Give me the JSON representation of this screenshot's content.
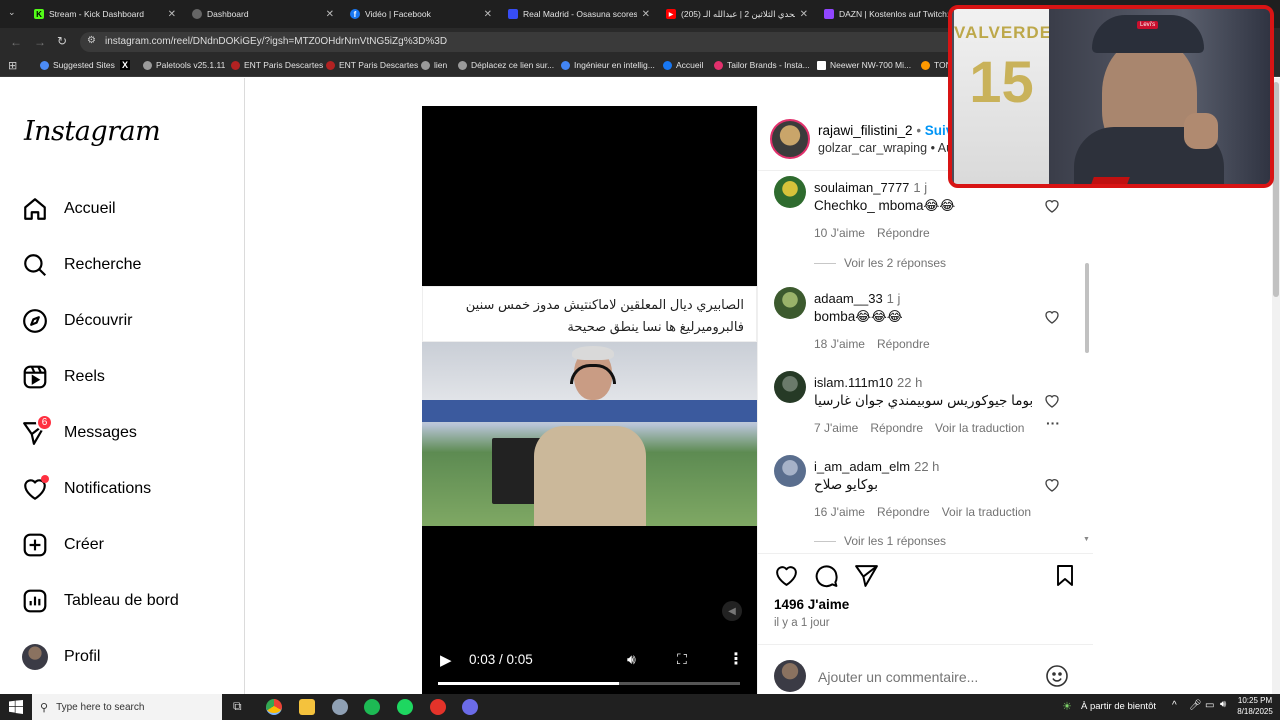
{
  "browser": {
    "tabs": [
      {
        "title": "Stream - Kick Dashboard",
        "icon": "kick-icon",
        "color": "#53fc18",
        "glyph": "K"
      },
      {
        "title": "Dashboard",
        "icon": "globe-icon",
        "color": "#888888",
        "glyph": ""
      },
      {
        "title": "Vidéo | Facebook",
        "icon": "facebook-icon",
        "color": "#1877f2",
        "glyph": "f"
      },
      {
        "title": "Real Madrid - Osasuna scores ...",
        "icon": "sofascore-icon",
        "color": "#374df5",
        "glyph": ""
      },
      {
        "title": "تحدي الثلاثين 2 | عبدالله الـ (205)",
        "icon": "youtube-icon",
        "color": "#ff0000",
        "glyph": "▶"
      },
      {
        "title": "DAZN | Kostenlos auf Twitch: ...",
        "icon": "twitch-icon",
        "color": "#9146ff",
        "glyph": ""
      }
    ],
    "url": "instagram.com/reel/DNdnDOKiGEy/?igsh=MTZ0OHdrNmVtNG5iZg%3D%3D",
    "bookmarks": [
      {
        "label": "Suggested Sites",
        "color": "#4c8bf5"
      },
      {
        "label": "",
        "color": "#000000",
        "glyph": "X"
      },
      {
        "label": "Paletools v25.1.11",
        "color": "#9a9a9a"
      },
      {
        "label": "ENT Paris Descartes",
        "color": "#b22222"
      },
      {
        "label": "ENT Paris Descartes",
        "color": "#b22222"
      },
      {
        "label": "lien",
        "color": "#9a9a9a"
      },
      {
        "label": "Déplacez ce lien sur...",
        "color": "#9a9a9a"
      },
      {
        "label": "Ingénieur en intellig...",
        "color": "#4285f4"
      },
      {
        "label": "Accueil",
        "color": "#1877f2"
      },
      {
        "label": "Tailor Brands - Insta...",
        "color": "#e1306c"
      },
      {
        "label": "Neewer NW-700 Mi...",
        "color": "#ffffff"
      },
      {
        "label": "TON",
        "color": "#ff9900"
      }
    ]
  },
  "sidebar": {
    "logo": "Instagram",
    "items": [
      {
        "label": "Accueil",
        "icon": "home-icon"
      },
      {
        "label": "Recherche",
        "icon": "search-icon"
      },
      {
        "label": "Découvrir",
        "icon": "compass-icon"
      },
      {
        "label": "Reels",
        "icon": "reels-icon"
      },
      {
        "label": "Messages",
        "icon": "messenger-icon",
        "badge": "6"
      },
      {
        "label": "Notifications",
        "icon": "heart-icon"
      },
      {
        "label": "Créer",
        "icon": "create-icon"
      },
      {
        "label": "Tableau de bord",
        "icon": "dashboard-icon"
      },
      {
        "label": "Profil",
        "icon": "avatar-icon"
      }
    ]
  },
  "video": {
    "caption_line1": "الصابيري ديال المعلقين لاماكنتيش مدوز خمس سنين",
    "caption_line2": "فالبروميرليغ ها نسا ينطق صحيحة",
    "time": "0:03 / 0:05",
    "progress": 0.6
  },
  "post": {
    "author": "rajawi_filistini_2",
    "follow": "Suivre",
    "subtitle": "golzar_car_wraping",
    "subtitle_extra": "Au...",
    "likes": "1496 J'aime",
    "date": "il y a 1 jour",
    "add_comment_placeholder": "Ajouter un commentaire..."
  },
  "comments": [
    {
      "user": "soulaiman_7777",
      "time": "1 j",
      "text": "Chechko_ mboma😂😂",
      "likes": "10 J'aime",
      "reply": "Répondre",
      "translate": "",
      "replies": "Voir les 2 réponses"
    },
    {
      "user": "adaam__33",
      "time": "1 j",
      "text": "bomba😂😂😂",
      "likes": "18 J'aime",
      "reply": "Répondre",
      "translate": "",
      "replies": ""
    },
    {
      "user": "islam.111m10",
      "time": "22 h",
      "text": "بوما جيوكوريس سوبيمندي جوان غارسيا",
      "likes": "7 J'aime",
      "reply": "Répondre",
      "translate": "Voir la traduction",
      "replies": ""
    },
    {
      "user": "i_am_adam_elm",
      "time": "22 h",
      "text": "بوكايو صلاح",
      "likes": "16 J'aime",
      "reply": "Répondre",
      "translate": "Voir la traduction",
      "replies": "Voir les 1 réponses"
    }
  ],
  "webcam": {
    "jersey_name": "VALVERDE",
    "jersey_number": "15",
    "cap_brand": "Levi's"
  },
  "taskbar": {
    "search_placeholder": "Type here to search",
    "weather": "À partir de bientôt",
    "time": "10:25 PM",
    "date": "8/18/2025"
  },
  "colors": {
    "accent_blue": "#0095f6",
    "browser_dark": "#1f1f1f",
    "webcam_border": "#d81414",
    "notification_red": "#ff3040"
  }
}
